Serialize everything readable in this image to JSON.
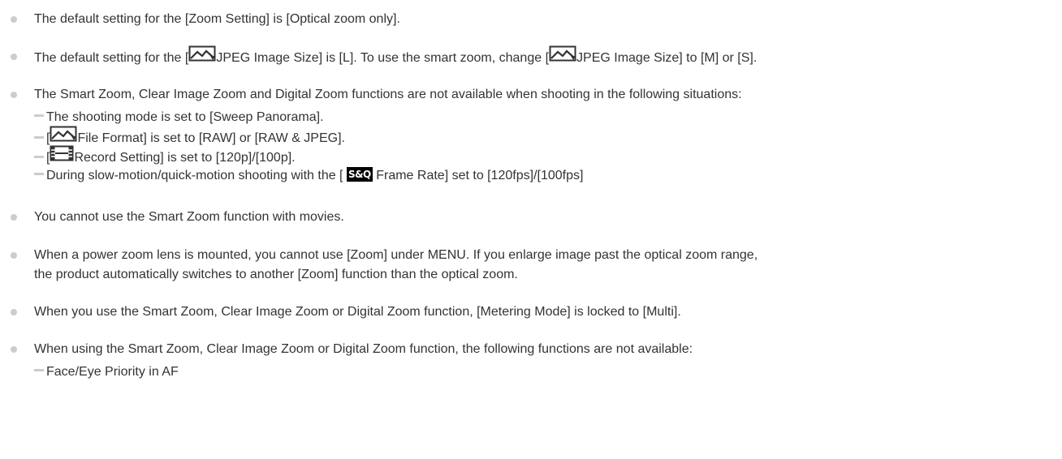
{
  "notes": {
    "item1": {
      "text": "The default setting for the [Zoom Setting] is [Optical zoom only]."
    },
    "item2": {
      "part1": "The default setting for the [",
      "part2": "JPEG Image Size] is [L]. To use the smart zoom, change [",
      "part3": "JPEG Image Size] to [M] or [S]."
    },
    "item3": {
      "text": "The Smart Zoom, Clear Image Zoom and Digital Zoom functions are not available when shooting in the following situations:",
      "sub1": "The shooting mode is set to [Sweep Panorama].",
      "sub2_part1": "[",
      "sub2_part2": "File Format] is set to [RAW] or [RAW & JPEG].",
      "sub3_part1": "[",
      "sub3_part2": "Record Setting] is set to [120p]/[100p].",
      "sub4_part1": "During slow-motion/quick-motion shooting with the [",
      "sub4_badge": "S&Q",
      "sub4_part2": "Frame Rate] set to [120fps]/[100fps]"
    },
    "item4": {
      "text": "You cannot use the Smart Zoom function with movies."
    },
    "item5": {
      "line1": "When a power zoom lens is mounted, you cannot use [Zoom] under MENU. If you enlarge image past the optical zoom range,",
      "line2": "the product automatically switches to another [Zoom] function than the optical zoom."
    },
    "item6": {
      "text": "When you use the Smart Zoom, Clear Image Zoom or Digital Zoom function, [Metering Mode] is locked to [Multi]."
    },
    "item7": {
      "text": "When using the Smart Zoom, Clear Image Zoom or Digital Zoom function, the following functions are not available:",
      "sub1": "Face/Eye Priority in AF"
    }
  },
  "icons": {
    "still_image": "still-image-icon",
    "movie": "movie-film-icon",
    "sq_badge": "s-and-q-badge-icon"
  },
  "colors": {
    "text": "#333333",
    "bullet": "#cccccc",
    "badge_bg": "#000000"
  }
}
